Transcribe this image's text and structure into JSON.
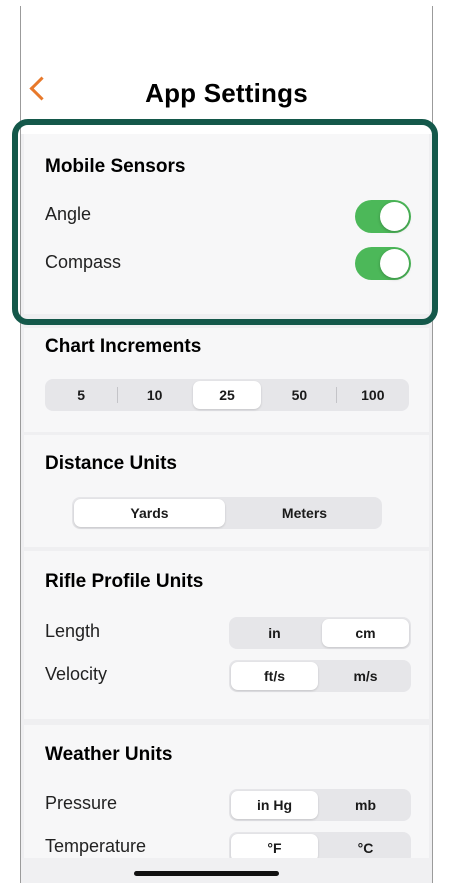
{
  "header": {
    "back_icon": "chevron-left-icon",
    "title": "App Settings",
    "accent": "#e8792b"
  },
  "mobile_sensors": {
    "title": "Mobile Sensors",
    "rows": [
      {
        "label": "Angle",
        "on": true
      },
      {
        "label": "Compass",
        "on": true
      }
    ],
    "toggle_color": "#4cb859",
    "highlight_color": "#14584a"
  },
  "chart_increments": {
    "title": "Chart Increments",
    "options": [
      "5",
      "10",
      "25",
      "50",
      "100"
    ],
    "selected": "25"
  },
  "distance_units": {
    "title": "Distance Units",
    "options": [
      "Yards",
      "Meters"
    ],
    "selected": "Yards"
  },
  "rifle_profile_units": {
    "title": "Rifle Profile Units",
    "length": {
      "label": "Length",
      "options": [
        "in",
        "cm"
      ],
      "selected": "cm"
    },
    "velocity": {
      "label": "Velocity",
      "options": [
        "ft/s",
        "m/s"
      ],
      "selected": "ft/s"
    }
  },
  "weather_units": {
    "title": "Weather Units",
    "pressure": {
      "label": "Pressure",
      "options": [
        "in Hg",
        "mb"
      ],
      "selected": "in Hg"
    },
    "temperature": {
      "label": "Temperature",
      "options": [
        "°F",
        "°C"
      ],
      "selected": "°F"
    }
  }
}
